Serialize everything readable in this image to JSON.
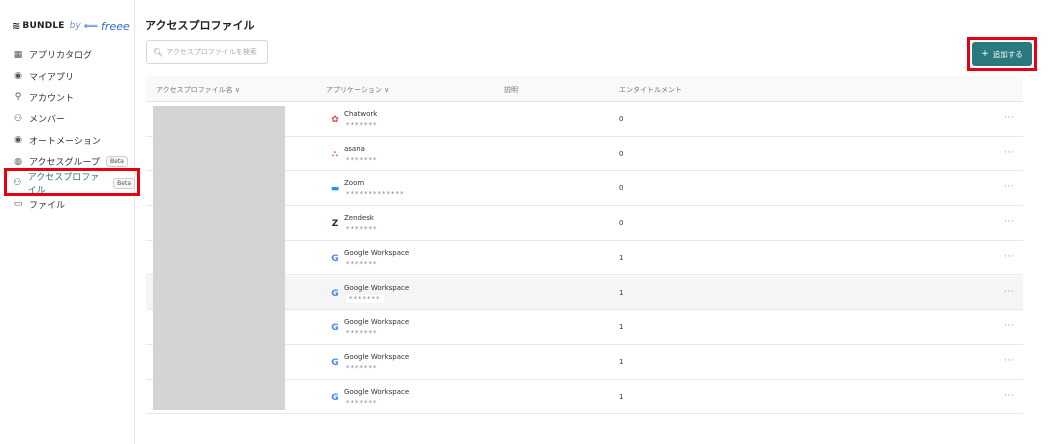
{
  "logo": {
    "bundle": "BUNDLE",
    "by": "by",
    "freee": "freee"
  },
  "sidebar": {
    "items": [
      {
        "label": "アプリカタログ",
        "icon": "grid-icon",
        "glyph": "▦"
      },
      {
        "label": "マイアプリ",
        "icon": "my-app-icon",
        "glyph": "◉"
      },
      {
        "label": "アカウント",
        "icon": "plug-icon",
        "glyph": "⚲"
      },
      {
        "label": "メンバー",
        "icon": "members-icon",
        "glyph": "⚇"
      },
      {
        "label": "オートメーション",
        "icon": "automation-icon",
        "glyph": "◉"
      },
      {
        "label": "アクセスグループ",
        "icon": "group-icon",
        "glyph": "◍",
        "badge": "Beta"
      },
      {
        "label": "アクセスプロファイル",
        "icon": "profile-icon",
        "glyph": "⚇",
        "badge": "Beta",
        "active": true
      },
      {
        "label": "ファイル",
        "icon": "folder-icon",
        "glyph": "▭"
      }
    ]
  },
  "header": {
    "title": "アクセスプロファイル"
  },
  "search": {
    "placeholder": "アクセスプロファイルを検索"
  },
  "toolbar": {
    "add_label": "追加する",
    "add_icon": "+"
  },
  "table": {
    "columns": [
      "アクセスプロファイル名 ∨",
      "アプリケーション ∨",
      "説明",
      "エンタイトルメント"
    ],
    "rows": [
      {
        "app": "Chatwork",
        "account": "*******",
        "entitlements": "0",
        "logo": "chatwork-logo"
      },
      {
        "app": "asana",
        "account": "*******",
        "entitlements": "0",
        "logo": "asana-logo"
      },
      {
        "app": "Zoom",
        "account": "*************",
        "entitlements": "0",
        "logo": "zoom-logo"
      },
      {
        "app": "Zendesk",
        "account": "*******",
        "entitlements": "0",
        "logo": "zendesk-logo"
      },
      {
        "app": "Google Workspace",
        "account": "*******",
        "entitlements": "1",
        "logo": "google-logo"
      },
      {
        "app": "Google Workspace",
        "account": "*******",
        "entitlements": "1",
        "logo": "google-logo"
      },
      {
        "app": "Google Workspace",
        "account": "*******",
        "entitlements": "1",
        "logo": "google-logo"
      },
      {
        "app": "Google Workspace",
        "account": "*******",
        "entitlements": "1",
        "logo": "google-logo"
      },
      {
        "app": "Google Workspace",
        "account": "*******",
        "entitlements": "1",
        "logo": "google-logo"
      }
    ],
    "more_icon": "···"
  },
  "colors": {
    "accent": "#2a7a7d",
    "highlight": "#e60012"
  }
}
